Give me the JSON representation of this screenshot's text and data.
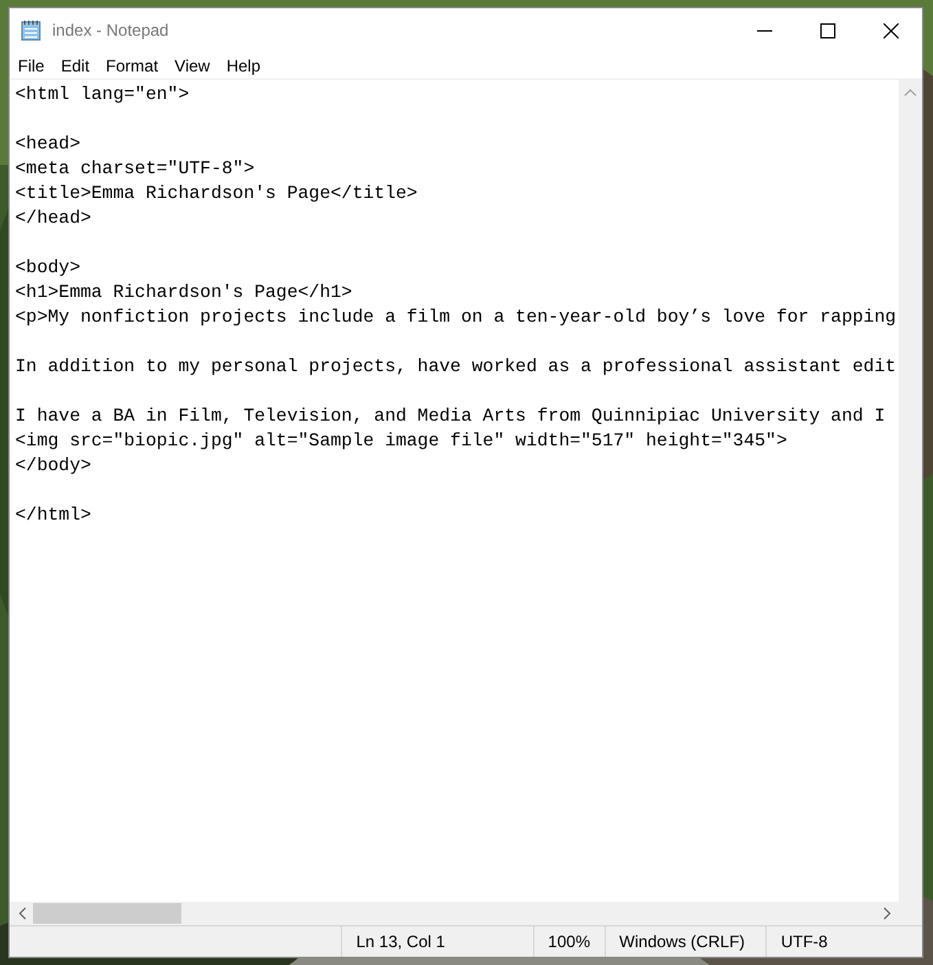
{
  "window": {
    "title": "index - Notepad"
  },
  "menu": [
    "File",
    "Edit",
    "Format",
    "View",
    "Help"
  ],
  "blocks": [
    [
      "<html lang=\"en\">"
    ],
    [
      "<head>",
      "<meta charset=\"UTF-8\">",
      "<title>Emma Richardson's Page</title>",
      "</head>"
    ],
    [
      "<body>",
      "<h1>Emma Richardson's Page</h1>",
      "<p>My nonfiction projects include a film on a ten-year-old boy’s love for rapping"
    ],
    [
      "In addition to my personal projects, have worked as a professional assistant edit"
    ],
    [
      "I have a BA in Film, Television, and Media Arts from Quinnipiac University and I",
      "<img src=\"biopic.jpg\" alt=\"Sample image file\" width=\"517\" height=\"345\">",
      "</body>"
    ],
    [
      "</html>"
    ]
  ],
  "status_bar": [
    "Ln 13, Col 1",
    "100%",
    "Windows (CRLF)",
    "UTF-8"
  ]
}
